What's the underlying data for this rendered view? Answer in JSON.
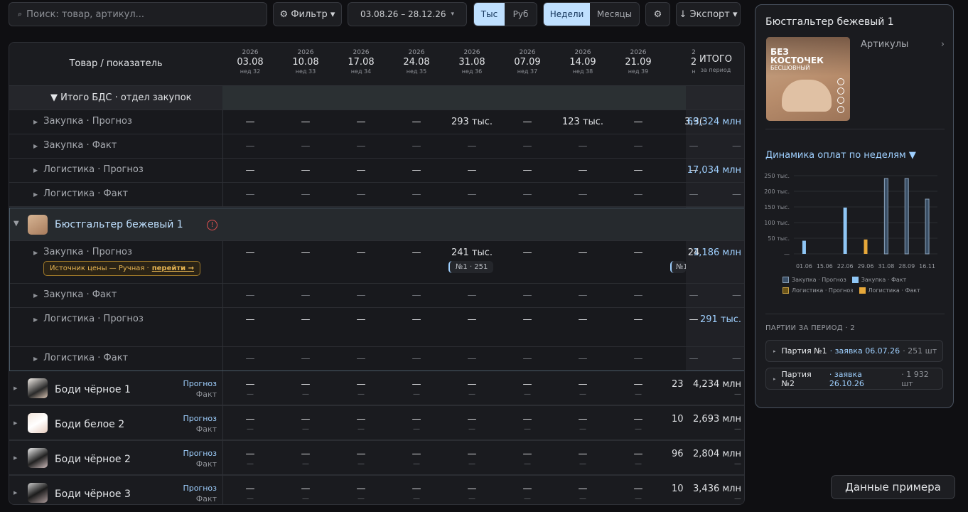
{
  "toolbar": {
    "search_placeholder": "Поиск: товар, артикул...",
    "search_icon": "⌕",
    "filter_label": "⚙ Фильтр ▾",
    "date_range": "03.08.26 – 28.12.26",
    "date_caret": "▾",
    "unit_thousand": "Тыс",
    "unit_rub": "Руб",
    "period_weeks": "Недели",
    "period_months": "Месяцы",
    "settings_icon": "⚙",
    "export_label": "↓ Экспорт ▾"
  },
  "table": {
    "header_label": "Товар / показатель",
    "total_label": "ИТОГО",
    "total_sub": "за период",
    "columns": [
      {
        "year": "2026",
        "date": "03.08",
        "week": "нед 32"
      },
      {
        "year": "2026",
        "date": "10.08",
        "week": "нед 33"
      },
      {
        "year": "2026",
        "date": "17.08",
        "week": "нед 34"
      },
      {
        "year": "2026",
        "date": "24.08",
        "week": "нед 35"
      },
      {
        "year": "2026",
        "date": "31.08",
        "week": "нед 36"
      },
      {
        "year": "2026",
        "date": "07.09",
        "week": "нед 37"
      },
      {
        "year": "2026",
        "date": "14.09",
        "week": "нед 38"
      },
      {
        "year": "2026",
        "date": "21.09",
        "week": "нед 39"
      },
      {
        "year": "2",
        "date": "2",
        "week": "н"
      }
    ],
    "summary_title": "▼ Итого БДС · отдел закупок",
    "summary_rows": [
      {
        "label": "Закупка · Прогноз",
        "cells": [
          "—",
          "—",
          "—",
          "—",
          "293 тыс.",
          "—",
          "123 тыс.",
          "—",
          "3,3("
        ],
        "total": "69,324 млн",
        "kind": "main"
      },
      {
        "label": "Закупка · Факт",
        "cells": [
          "—",
          "—",
          "—",
          "—",
          "—",
          "—",
          "—",
          "—",
          "—"
        ],
        "total": "—",
        "kind": "fact"
      },
      {
        "label": "Логистика · Прогноз",
        "cells": [
          "—",
          "—",
          "—",
          "—",
          "—",
          "—",
          "—",
          "—",
          "—"
        ],
        "total": "17,034 млн",
        "kind": "main"
      },
      {
        "label": "Логистика · Факт",
        "cells": [
          "—",
          "—",
          "—",
          "—",
          "—",
          "—",
          "—",
          "—",
          "—"
        ],
        "total": "—",
        "kind": "fact"
      }
    ],
    "product_expanded": {
      "name": "Бюстгальтер бежевый 1",
      "warning_icon": "!",
      "rows": [
        {
          "label": "Закупка · Прогноз",
          "cells": [
            "—",
            "—",
            "—",
            "—",
            "241 тыс.",
            "—",
            "—",
            "—",
            "24"
          ],
          "total": "1,186 млн",
          "kind": "main"
        },
        {
          "label": "Закупка · Факт",
          "cells": [
            "—",
            "—",
            "—",
            "—",
            "—",
            "—",
            "—",
            "—",
            "—"
          ],
          "total": "—",
          "kind": "fact"
        },
        {
          "label": "Логистика · Прогноз",
          "cells": [
            "—",
            "—",
            "—",
            "—",
            "—",
            "—",
            "—",
            "—",
            "—"
          ],
          "total": "291 тыс.",
          "kind": "main"
        },
        {
          "label": "Логистика · Факт",
          "cells": [
            "—",
            "—",
            "—",
            "—",
            "—",
            "—",
            "—",
            "—",
            "—"
          ],
          "total": "—",
          "kind": "fact"
        }
      ],
      "price_source_text": "Источник цены — Ручная ·",
      "price_source_link": "перейти →",
      "batch_chip": "№1 · 251",
      "batch_chip_cut": "№1"
    },
    "products": [
      {
        "name": "Боди чёрное 1",
        "forecast": "Прогноз",
        "fact": "Факт",
        "last": "23",
        "total": "4,234 млн"
      },
      {
        "name": "Боди белое 2",
        "forecast": "Прогноз",
        "fact": "Факт",
        "last": "10",
        "total": "2,693 млн"
      },
      {
        "name": "Боди чёрное 2",
        "forecast": "Прогноз",
        "fact": "Факт",
        "last": "96",
        "total": "2,804 млн"
      },
      {
        "name": "Боди чёрное 3",
        "forecast": "Прогноз",
        "fact": "Факт",
        "last": "10",
        "total": "3,436 млн"
      }
    ],
    "dash": "—"
  },
  "panel": {
    "title": "Бюстгальтер бежевый 1",
    "articles_label": "Артикулы",
    "articles_caret": "›",
    "image_text_1": "БЕЗ",
    "image_text_2": "КОСТОЧЕК",
    "image_text_3": "БЕСШОВНЫЙ",
    "chart_title": "Динамика оплат по неделям ▼",
    "batches_title": "ПАРТИИ ЗА ПЕРИОД · 2",
    "batches": [
      {
        "name": "Партия №1",
        "request": "· заявка 06.07.26",
        "qty": "· 251 шт"
      },
      {
        "name": "Партия №2",
        "request": "· заявка 26.10.26",
        "qty": "· 1 932 шт"
      }
    ]
  },
  "chart_data": {
    "type": "bar",
    "categories": [
      "01.06",
      "15.06",
      "22.06",
      "29.06",
      "31.08",
      "28.09",
      "16.11"
    ],
    "ytick_labels": [
      "250 тыс.",
      "200 тыс.",
      "150 тыс.",
      "100 тыс.",
      "50 тыс.",
      "—"
    ],
    "ylim": [
      0,
      250000
    ],
    "series": [
      {
        "name": "Закупка · Прогноз",
        "color": "#3a4f66",
        "values": [
          0,
          0,
          0,
          0,
          241000,
          241000,
          175000
        ]
      },
      {
        "name": "Закупка · Факт",
        "color": "#8fc6f5",
        "values": [
          42000,
          0,
          148000,
          0,
          0,
          0,
          0
        ]
      },
      {
        "name": "Логистика · Прогноз",
        "color": "#6b5418",
        "values": [
          0,
          0,
          0,
          0,
          0,
          0,
          0
        ]
      },
      {
        "name": "Логистика · Факт",
        "color": "#e7a83a",
        "values": [
          0,
          0,
          0,
          46000,
          0,
          0,
          0
        ]
      }
    ]
  },
  "footer": {
    "sample_button": "Данные примера"
  }
}
